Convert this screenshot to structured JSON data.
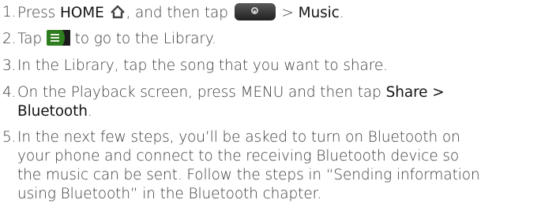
{
  "steps": [
    {
      "number": "1.",
      "parts": {
        "a": "Press ",
        "home": "HOME",
        "b": ", and then tap ",
        "c": " > ",
        "music": "Music",
        "d": "."
      }
    },
    {
      "number": "2.",
      "parts": {
        "a": "Tap ",
        "b": " to go to the Library."
      }
    },
    {
      "number": "3.",
      "text": "In the Library, tap the song that you want to share."
    },
    {
      "number": "4.",
      "parts": {
        "a": "On the Playback screen, press ",
        "menu": "MENU",
        "b": " and then tap ",
        "share": "Share >",
        "bluetooth": "Bluetooth",
        "c": "."
      }
    },
    {
      "number": "5.",
      "lines": [
        "In the next few steps, you’ll be asked to turn on Bluetooth on",
        "your phone and connect to the receiving Bluetooth device so",
        "the music can be sent. Follow the steps in “Sending information",
        "using Bluetooth” in the Bluetooth chapter."
      ]
    }
  ],
  "icons": {
    "home": "home-icon",
    "apps": "all-apps-button-icon",
    "library": "library-tab-icon"
  },
  "colors": {
    "text": "#3a3a3a",
    "library_icon": "#2e7d1f"
  }
}
